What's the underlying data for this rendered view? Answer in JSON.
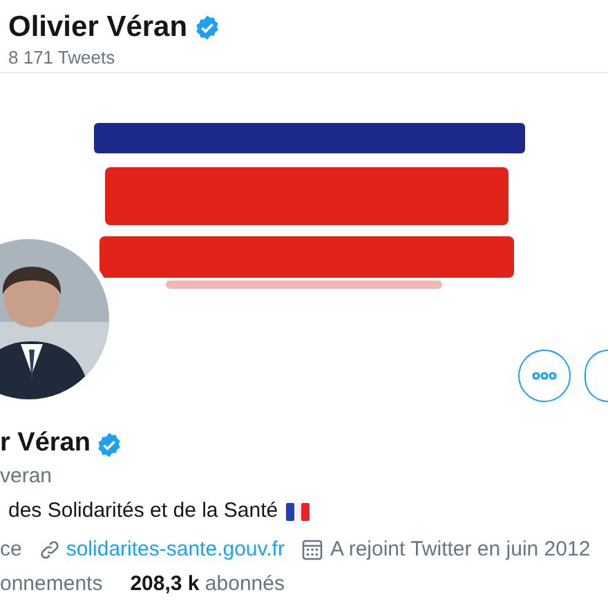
{
  "header": {
    "name": "Olivier Véran",
    "verified": true,
    "tweet_count": "8 171 Tweets"
  },
  "actions": [
    {
      "kind": "more"
    },
    {
      "kind": "cut"
    }
  ],
  "profile": {
    "name": "r Véran",
    "verified": true,
    "handle": "veran",
    "bio": "des Solidarités et de la Santé",
    "bio_flag": true,
    "location": "ce",
    "website": "solidarites-sante.gouv.fr",
    "joined": "A rejoint Twitter en juin 2012"
  },
  "stats": [
    {
      "text": "onnements"
    },
    {
      "text": "**208,3 k** abonnés"
    }
  ]
}
